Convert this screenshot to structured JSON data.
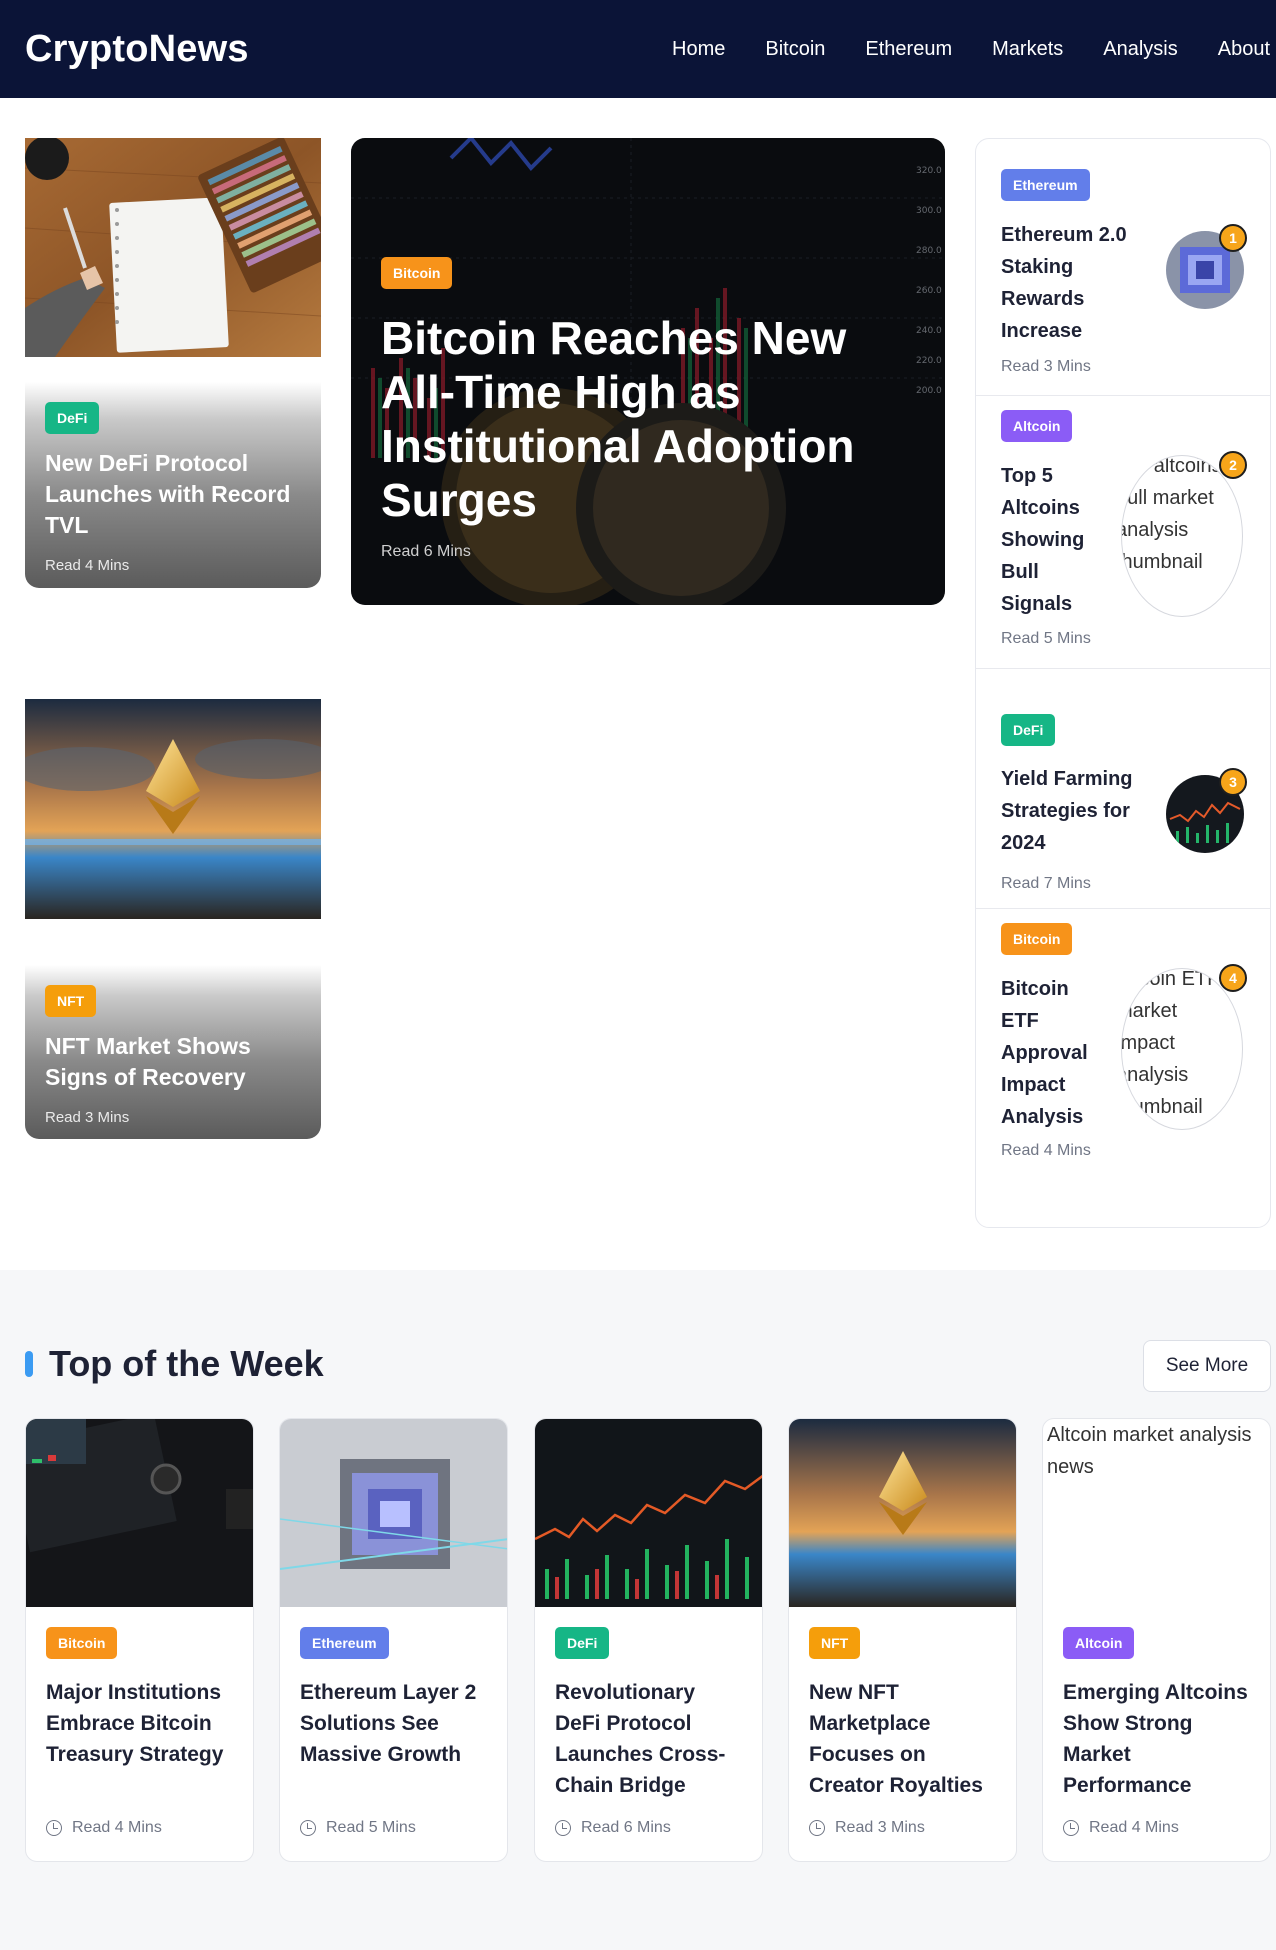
{
  "header": {
    "logo": "CryptoNews",
    "nav": [
      "Home",
      "Bitcoin",
      "Ethereum",
      "Markets",
      "Analysis",
      "About"
    ]
  },
  "left_column": [
    {
      "category": "DeFi",
      "title": "New DeFi Protocol Launches with Record TVL",
      "read": "Read 4 Mins"
    },
    {
      "category": "NFT",
      "title": "NFT Market Shows Signs of Recovery",
      "read": "Read 3 Mins"
    }
  ],
  "feature": {
    "category": "Bitcoin",
    "title": "Bitcoin Reaches New All-Time High as Institutional Adoption Surges",
    "read": "Read 6 Mins"
  },
  "sidebar": [
    {
      "category": "Ethereum",
      "title": "Ethereum 2.0 Staking Rewards Increase",
      "read": "Read 3 Mins",
      "rank": "1"
    },
    {
      "category": "Altcoin",
      "title": "Top 5 Altcoins Showing Bull Signals",
      "read": "Read 5 Mins",
      "rank": "2",
      "alt": "Top altcoins bull market analysis thumbnail"
    },
    {
      "category": "DeFi",
      "title": "Yield Farming Strategies for 2024",
      "read": "Read 7 Mins",
      "rank": "3"
    },
    {
      "category": "Bitcoin",
      "title": "Bitcoin ETF Approval Impact Analysis",
      "read": "Read 4 Mins",
      "rank": "4",
      "alt": "Bitcoin ETF market impact analysis thumbnail"
    }
  ],
  "week": {
    "title": "Top of the Week",
    "see_more": "See More",
    "cards": [
      {
        "category": "Bitcoin",
        "title": "Major Institutions Embrace Bitcoin Treasury Strategy",
        "read": "Read 4 Mins"
      },
      {
        "category": "Ethereum",
        "title": "Ethereum Layer 2 Solutions See Massive Growth",
        "read": "Read 5 Mins"
      },
      {
        "category": "DeFi",
        "title": "Revolutionary DeFi Protocol Launches Cross-Chain Bridge",
        "read": "Read 6 Mins"
      },
      {
        "category": "NFT",
        "title": "New NFT Marketplace Focuses on Creator Royalties",
        "read": "Read 3 Mins"
      },
      {
        "category": "Altcoin",
        "title": "Emerging Altcoins Show Strong Market Performance",
        "read": "Read 4 Mins",
        "alt": "Altcoin market analysis news"
      }
    ]
  },
  "colors": {
    "header_bg": "#0b1437",
    "bitcoin": "#f7931a",
    "ethereum": "#627eea",
    "defi": "#16b686",
    "altcoin": "#8b5cf6",
    "nft": "#f59e0b",
    "accent_bar": "#3b9bf2"
  }
}
